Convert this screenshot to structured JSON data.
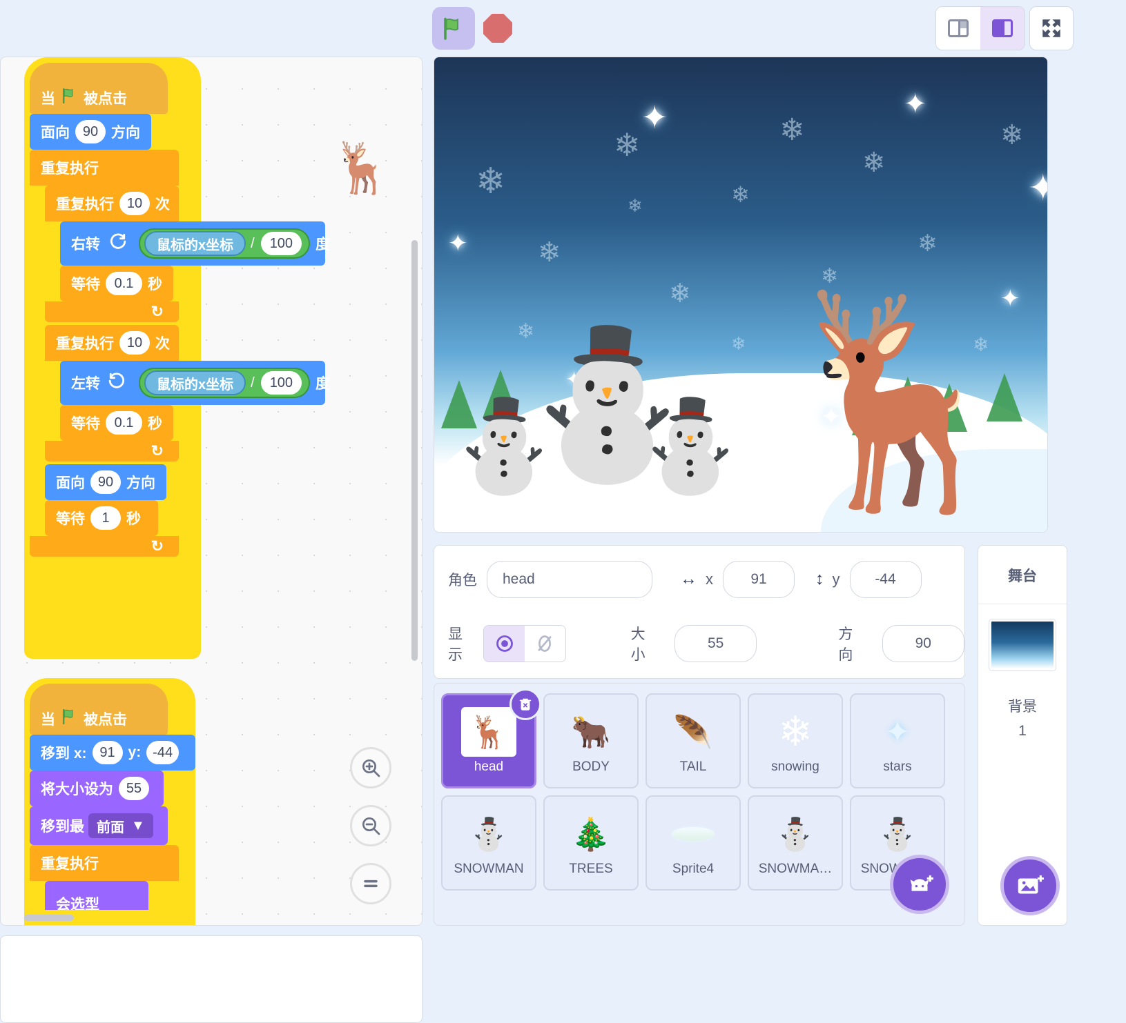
{
  "toolbar": {
    "green_flag": "green-flag",
    "stop": "stop-sign",
    "layout_small": "small-stage-layout",
    "layout_large": "large-stage-layout",
    "fullscreen": "fullscreen"
  },
  "code": {
    "scripts": [
      {
        "blocks": [
          {
            "type": "hat",
            "parts": [
              "当",
              "flag",
              "被点击"
            ]
          },
          {
            "type": "motion",
            "parts": [
              "面向",
              {
                "oval": "90"
              },
              "方向"
            ]
          },
          {
            "type": "control",
            "parts": [
              "重复执行"
            ]
          },
          {
            "type": "control",
            "parts": [
              "重复执行",
              {
                "oval": "10"
              },
              "次"
            ]
          },
          {
            "type": "motion",
            "parts": [
              "右转",
              "cw",
              {
                "op": [
                  "鼠标的x坐标",
                  "/",
                  "100"
                ]
              },
              "度"
            ]
          },
          {
            "type": "control",
            "parts": [
              "等待",
              {
                "oval": "0.1"
              },
              "秒"
            ]
          },
          {
            "type": "control",
            "parts": [
              "重复执行",
              {
                "oval": "10"
              },
              "次"
            ]
          },
          {
            "type": "motion",
            "parts": [
              "左转",
              "ccw",
              {
                "op": [
                  "鼠标的x坐标",
                  "/",
                  "100"
                ]
              },
              "度"
            ]
          },
          {
            "type": "control",
            "parts": [
              "等待",
              {
                "oval": "0.1"
              },
              "秒"
            ]
          },
          {
            "type": "motion",
            "parts": [
              "面向",
              {
                "oval": "90"
              },
              "方向"
            ]
          },
          {
            "type": "control",
            "parts": [
              "等待",
              {
                "oval": "1"
              },
              "秒"
            ]
          }
        ]
      },
      {
        "blocks": [
          {
            "type": "hat",
            "parts": [
              "当",
              "flag",
              "被点击"
            ]
          },
          {
            "type": "motion",
            "parts": [
              "移到 x:",
              {
                "oval": "91"
              },
              "y:",
              {
                "oval": "-44"
              }
            ]
          },
          {
            "type": "looks",
            "parts": [
              "将大小设为",
              {
                "oval": "55"
              }
            ]
          },
          {
            "type": "looks",
            "parts": [
              "移到最",
              {
                "dropdown": "前面"
              }
            ]
          },
          {
            "type": "control",
            "parts": [
              "重复执行"
            ]
          },
          {
            "type": "looks",
            "parts": [
              "会选型"
            ]
          }
        ]
      }
    ],
    "labels": {
      "when": "当",
      "clicked": "被点击",
      "point_direction_pre": "面向",
      "point_direction_post": "方向",
      "forever": "重复执行",
      "repeat_pre": "重复执行",
      "repeat_post": "次",
      "turn_right": "右转",
      "turn_left": "左转",
      "degrees": "度",
      "wait_pre": "等待",
      "wait_post": "秒",
      "mouse_x": "鼠标的x坐标",
      "divide": "/",
      "goto_x": "移到 x:",
      "goto_y": "y:",
      "set_size": "将大小设为",
      "go_to_layer": "移到最",
      "front": "前面",
      "partial_block": "会选型"
    },
    "values": {
      "direction_90": "90",
      "repeat_10": "10",
      "divisor_100": "100",
      "wait_01": "0.1",
      "wait_1": "1",
      "x_91": "91",
      "y_minus44": "-44",
      "size_55": "55"
    },
    "zoom_controls": {
      "zoom_in": "zoom-in",
      "zoom_out": "zoom-out",
      "zoom_reset": "zoom-reset"
    }
  },
  "sprite_info": {
    "sprite_label": "角色",
    "sprite_name": "head",
    "x_label": "x",
    "x_value": "91",
    "y_label": "y",
    "y_value": "-44",
    "show_label": "显示",
    "size_label": "大小",
    "size_value": "55",
    "direction_label": "方向",
    "direction_value": "90",
    "visible_on_icon": "eye-icon",
    "visible_off_icon": "eye-slash-icon"
  },
  "sprites": [
    {
      "name": "head",
      "icon": "reindeer",
      "selected": true
    },
    {
      "name": "BODY",
      "icon": "deer-body",
      "selected": false
    },
    {
      "name": "TAIL",
      "icon": "tail",
      "selected": false
    },
    {
      "name": "snowing",
      "icon": "snowflake",
      "selected": false
    },
    {
      "name": "stars",
      "icon": "star",
      "selected": false
    },
    {
      "name": "SNOWMAN",
      "icon": "snowman",
      "selected": false
    },
    {
      "name": "TREES",
      "icon": "tree",
      "selected": false
    },
    {
      "name": "Sprite4",
      "icon": "snowdrift",
      "selected": false
    },
    {
      "name": "SNOWMA…",
      "icon": "snowman",
      "selected": false
    },
    {
      "name": "SNOWMA…",
      "icon": "snowman",
      "selected": false
    }
  ],
  "stage_panel": {
    "title": "舞台",
    "backdrop_label": "背景",
    "backdrop_count": "1",
    "add_backdrop_icon": "add-backdrop-icon"
  },
  "sprite_list_actions": {
    "delete_icon": "trash-icon",
    "add_sprite_icon": "add-sprite-cat-icon"
  },
  "colors": {
    "motion": "#4c97ff",
    "control": "#ffab19",
    "looks": "#9966ff",
    "operator": "#59c059",
    "sensing": "#6fb8e0",
    "events": "#f2b33d",
    "accent": "#7b55d6",
    "glow": "#ffdf1c",
    "page_bg": "#e8f0fc"
  }
}
